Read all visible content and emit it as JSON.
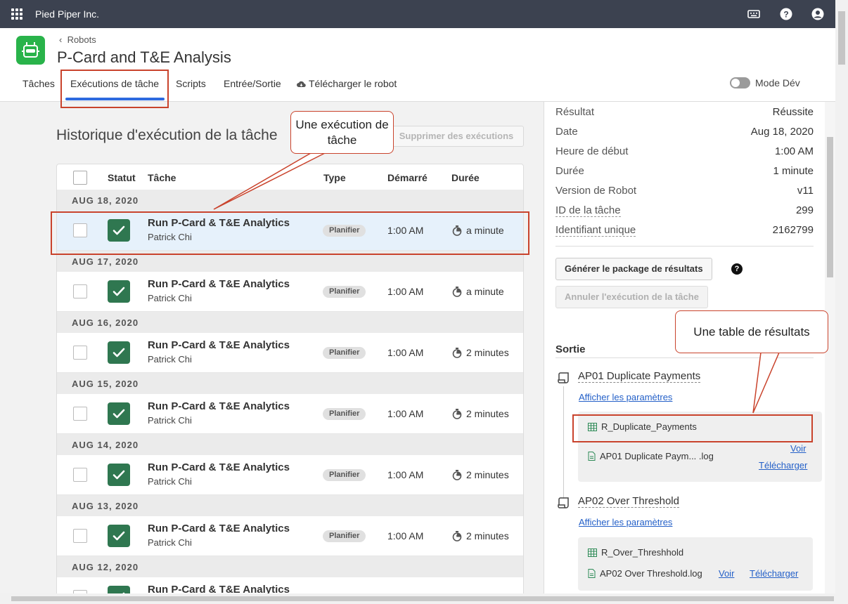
{
  "topbar": {
    "org": "Pied Piper Inc."
  },
  "header": {
    "breadcrumb": "Robots",
    "title": "P-Card and T&E Analysis",
    "tabs": [
      "Tâches",
      "Exécutions de tâche",
      "Scripts",
      "Entrée/Sortie",
      "Télécharger le robot"
    ],
    "active_tab": "Exécutions de tâche",
    "dev_mode_label": "Mode Dév",
    "dev_mode_on": false
  },
  "main": {
    "title": "Historique d'exécution de la tâche",
    "delete_button": "Supprimer des exécutions",
    "columns": [
      "Statut",
      "Tâche",
      "Type",
      "Démarré",
      "Durée"
    ],
    "groups": [
      {
        "date": "AUG 18, 2020",
        "task": "Run P-Card & T&E Analytics",
        "user": "Patrick Chi",
        "type": "Planifier",
        "start": "1:00 AM",
        "duration": "a minute"
      },
      {
        "date": "AUG 17, 2020",
        "task": "Run P-Card & T&E Analytics",
        "user": "Patrick Chi",
        "type": "Planifier",
        "start": "1:00 AM",
        "duration": "a minute"
      },
      {
        "date": "AUG 16, 2020",
        "task": "Run P-Card & T&E Analytics",
        "user": "Patrick Chi",
        "type": "Planifier",
        "start": "1:00 AM",
        "duration": "2 minutes"
      },
      {
        "date": "AUG 15, 2020",
        "task": "Run P-Card & T&E Analytics",
        "user": "Patrick Chi",
        "type": "Planifier",
        "start": "1:00 AM",
        "duration": "2 minutes"
      },
      {
        "date": "AUG 14, 2020",
        "task": "Run P-Card & T&E Analytics",
        "user": "Patrick Chi",
        "type": "Planifier",
        "start": "1:00 AM",
        "duration": "2 minutes"
      },
      {
        "date": "AUG 13, 2020",
        "task": "Run P-Card & T&E Analytics",
        "user": "Patrick Chi",
        "type": "Planifier",
        "start": "1:00 AM",
        "duration": "2 minutes"
      },
      {
        "date": "AUG 12, 2020",
        "task": "Run P-Card & T&E Analytics",
        "user": "",
        "type": "",
        "start": "",
        "duration": ""
      }
    ]
  },
  "details": {
    "fields": [
      {
        "label": "Résultat",
        "value": "Réussite"
      },
      {
        "label": "Date",
        "value": "Aug 18, 2020"
      },
      {
        "label": "Heure de début",
        "value": "1:00 AM"
      },
      {
        "label": "Durée",
        "value": "1 minute"
      },
      {
        "label": "Version de Robot",
        "value": "v11"
      },
      {
        "label": "ID de la tâche",
        "value": "299"
      },
      {
        "label": "Identifiant unique",
        "value": "2162799"
      }
    ],
    "generate_button": "Générer le package de résultats",
    "cancel_button": "Annuler l'exécution de la tâche",
    "output_title": "Sortie",
    "outputs": [
      {
        "name": "AP01 Duplicate Payments",
        "params_link": "Afficher les paramètres",
        "table": "R_Duplicate_Payments",
        "log": "AP01 Duplicate Paym... .log",
        "view": "Voir",
        "download": "Télécharger"
      },
      {
        "name": "AP02 Over Threshold",
        "params_link": "Afficher les paramètres",
        "table": "R_Over_Threshhold",
        "log": "AP02 Over Threshold.log",
        "view": "Voir",
        "download": "Télécharger"
      }
    ]
  },
  "annotations": {
    "task_run_callout": "Une exécution de tâche",
    "result_table_callout": "Une table de résultats"
  },
  "colors": {
    "topbar": "#3c4250",
    "success": "#2f7750",
    "accent": "#2d6ae0",
    "annotation": "#c9432c",
    "app_icon": "#29b34a"
  }
}
